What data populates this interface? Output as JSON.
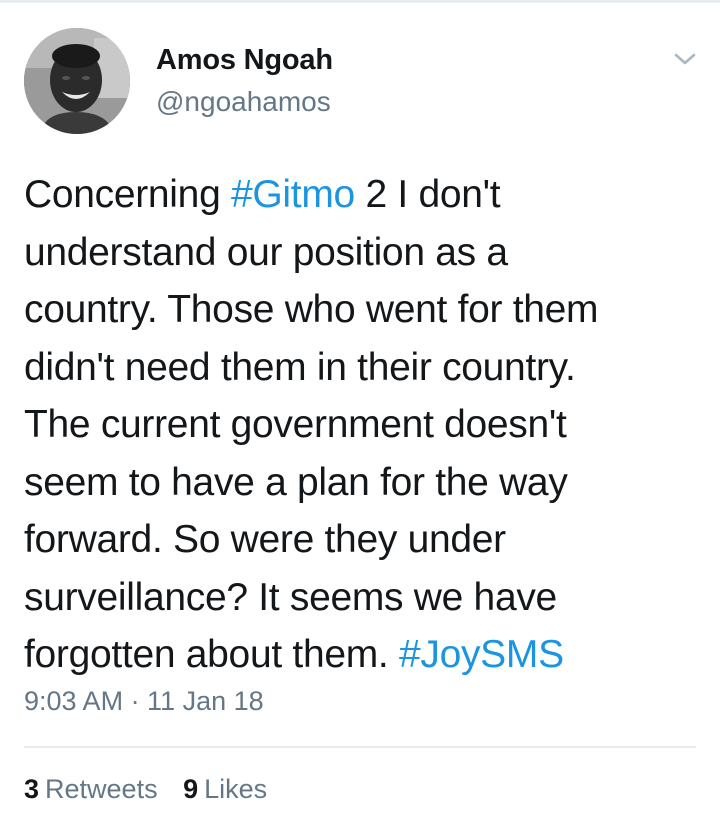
{
  "author": {
    "name": "Amos Ngoah",
    "handle": "@ngoahamos",
    "avatar_icon": "profile-photo"
  },
  "tweet": {
    "lines": [
      [
        {
          "text": "Concerning "
        },
        {
          "text": "#Gitmo",
          "hashtag": true
        },
        {
          "text": " 2 I don't"
        }
      ],
      [
        {
          "text": "understand our position as a"
        }
      ],
      [
        {
          "text": "country. Those who went for them"
        }
      ],
      [
        {
          "text": "didn't need them in their country."
        }
      ],
      [
        {
          "text": "The current government doesn't"
        }
      ],
      [
        {
          "text": "seem to have a plan for the way"
        }
      ],
      [
        {
          "text": "forward. So were they under"
        }
      ],
      [
        {
          "text": "surveillance? It seems we have"
        }
      ],
      [
        {
          "text": "forgotten about them. "
        },
        {
          "text": "#JoySMS",
          "hashtag": true
        }
      ]
    ],
    "timestamp": "9:03 AM · 11 Jan 18"
  },
  "stats": {
    "retweets_count": "3",
    "retweets_label": "Retweets",
    "likes_count": "9",
    "likes_label": "Likes"
  },
  "colors": {
    "hashtag": "#1b95e0",
    "secondary_text": "#657786",
    "primary_text": "#14171a",
    "divider": "#e6ecf0"
  },
  "icons": {
    "menu": "chevron-down-icon"
  }
}
